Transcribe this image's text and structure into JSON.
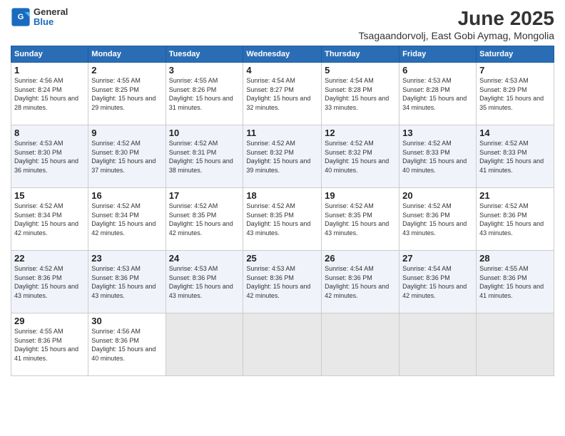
{
  "header": {
    "logo": {
      "general": "General",
      "blue": "Blue"
    },
    "title": "June 2025",
    "subtitle": "Tsagaandorvolj, East Gobi Aymag, Mongolia"
  },
  "calendar": {
    "weekdays": [
      "Sunday",
      "Monday",
      "Tuesday",
      "Wednesday",
      "Thursday",
      "Friday",
      "Saturday"
    ],
    "weeks": [
      [
        {
          "day": "1",
          "sunrise": "4:56 AM",
          "sunset": "8:24 PM",
          "daylight": "15 hours and 28 minutes."
        },
        {
          "day": "2",
          "sunrise": "4:55 AM",
          "sunset": "8:25 PM",
          "daylight": "15 hours and 29 minutes."
        },
        {
          "day": "3",
          "sunrise": "4:55 AM",
          "sunset": "8:26 PM",
          "daylight": "15 hours and 31 minutes."
        },
        {
          "day": "4",
          "sunrise": "4:54 AM",
          "sunset": "8:27 PM",
          "daylight": "15 hours and 32 minutes."
        },
        {
          "day": "5",
          "sunrise": "4:54 AM",
          "sunset": "8:28 PM",
          "daylight": "15 hours and 33 minutes."
        },
        {
          "day": "6",
          "sunrise": "4:53 AM",
          "sunset": "8:28 PM",
          "daylight": "15 hours and 34 minutes."
        },
        {
          "day": "7",
          "sunrise": "4:53 AM",
          "sunset": "8:29 PM",
          "daylight": "15 hours and 35 minutes."
        }
      ],
      [
        {
          "day": "8",
          "sunrise": "4:53 AM",
          "sunset": "8:30 PM",
          "daylight": "15 hours and 36 minutes."
        },
        {
          "day": "9",
          "sunrise": "4:52 AM",
          "sunset": "8:30 PM",
          "daylight": "15 hours and 37 minutes."
        },
        {
          "day": "10",
          "sunrise": "4:52 AM",
          "sunset": "8:31 PM",
          "daylight": "15 hours and 38 minutes."
        },
        {
          "day": "11",
          "sunrise": "4:52 AM",
          "sunset": "8:32 PM",
          "daylight": "15 hours and 39 minutes."
        },
        {
          "day": "12",
          "sunrise": "4:52 AM",
          "sunset": "8:32 PM",
          "daylight": "15 hours and 40 minutes."
        },
        {
          "day": "13",
          "sunrise": "4:52 AM",
          "sunset": "8:33 PM",
          "daylight": "15 hours and 40 minutes."
        },
        {
          "day": "14",
          "sunrise": "4:52 AM",
          "sunset": "8:33 PM",
          "daylight": "15 hours and 41 minutes."
        }
      ],
      [
        {
          "day": "15",
          "sunrise": "4:52 AM",
          "sunset": "8:34 PM",
          "daylight": "15 hours and 42 minutes."
        },
        {
          "day": "16",
          "sunrise": "4:52 AM",
          "sunset": "8:34 PM",
          "daylight": "15 hours and 42 minutes."
        },
        {
          "day": "17",
          "sunrise": "4:52 AM",
          "sunset": "8:35 PM",
          "daylight": "15 hours and 42 minutes."
        },
        {
          "day": "18",
          "sunrise": "4:52 AM",
          "sunset": "8:35 PM",
          "daylight": "15 hours and 43 minutes."
        },
        {
          "day": "19",
          "sunrise": "4:52 AM",
          "sunset": "8:35 PM",
          "daylight": "15 hours and 43 minutes."
        },
        {
          "day": "20",
          "sunrise": "4:52 AM",
          "sunset": "8:36 PM",
          "daylight": "15 hours and 43 minutes."
        },
        {
          "day": "21",
          "sunrise": "4:52 AM",
          "sunset": "8:36 PM",
          "daylight": "15 hours and 43 minutes."
        }
      ],
      [
        {
          "day": "22",
          "sunrise": "4:52 AM",
          "sunset": "8:36 PM",
          "daylight": "15 hours and 43 minutes."
        },
        {
          "day": "23",
          "sunrise": "4:53 AM",
          "sunset": "8:36 PM",
          "daylight": "15 hours and 43 minutes."
        },
        {
          "day": "24",
          "sunrise": "4:53 AM",
          "sunset": "8:36 PM",
          "daylight": "15 hours and 43 minutes."
        },
        {
          "day": "25",
          "sunrise": "4:53 AM",
          "sunset": "8:36 PM",
          "daylight": "15 hours and 42 minutes."
        },
        {
          "day": "26",
          "sunrise": "4:54 AM",
          "sunset": "8:36 PM",
          "daylight": "15 hours and 42 minutes."
        },
        {
          "day": "27",
          "sunrise": "4:54 AM",
          "sunset": "8:36 PM",
          "daylight": "15 hours and 42 minutes."
        },
        {
          "day": "28",
          "sunrise": "4:55 AM",
          "sunset": "8:36 PM",
          "daylight": "15 hours and 41 minutes."
        }
      ],
      [
        {
          "day": "29",
          "sunrise": "4:55 AM",
          "sunset": "8:36 PM",
          "daylight": "15 hours and 41 minutes."
        },
        {
          "day": "30",
          "sunrise": "4:56 AM",
          "sunset": "8:36 PM",
          "daylight": "15 hours and 40 minutes."
        },
        null,
        null,
        null,
        null,
        null
      ]
    ],
    "labels": {
      "sunrise": "Sunrise:",
      "sunset": "Sunset:",
      "daylight": "Daylight:"
    }
  }
}
